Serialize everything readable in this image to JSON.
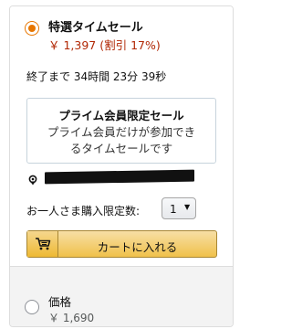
{
  "deal_option": {
    "title": "特選タイムセール",
    "price": "￥ 1,397 (割引 17%)",
    "countdown": "終了まで 34時間 23分 39秒",
    "notice_title": "プライム会員限定セール",
    "notice_line1": "プライム会員だけが参加でき",
    "notice_line2": "るタイムセールです",
    "quantity_limit_label": "お一人さま購入限定数:",
    "quantity_value": "1",
    "add_to_cart_label": "カートに入れる",
    "selected": true
  },
  "price_option": {
    "title": "価格",
    "price": "￥ 1,690",
    "selected": false
  },
  "icons": {
    "location": "location-pin-icon",
    "cart": "shopping-cart-icon",
    "dropdown": "chevron-down-icon"
  },
  "colors": {
    "accent": "#e77600",
    "deal_price": "#b12704",
    "cart_button": "#f0c14b"
  }
}
